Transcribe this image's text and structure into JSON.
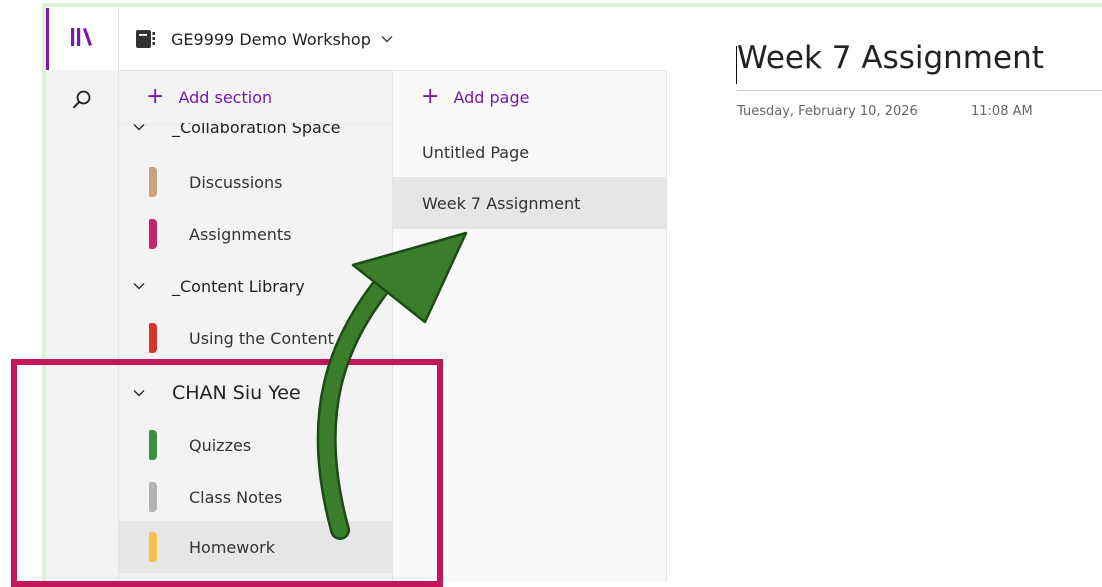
{
  "notebook": {
    "title": "GE9999 Demo Workshop",
    "chevron": "⌄"
  },
  "sections_pane": {
    "add_label": "Add section",
    "groups": [
      {
        "label": "_Collaboration Space",
        "expanded": true
      },
      {
        "label": "_Content Library",
        "expanded": true
      },
      {
        "label": "CHAN Siu Yee",
        "expanded": true
      }
    ],
    "sections": [
      {
        "label": "Discussions",
        "color": "#c9a27e"
      },
      {
        "label": "Assignments",
        "color": "#c2266b"
      },
      {
        "label": "Using the Content L",
        "color": "#d6322b"
      },
      {
        "label": "Quizzes",
        "color": "#3e8e41"
      },
      {
        "label": "Class Notes",
        "color": "#b3b3b3"
      },
      {
        "label": "Homework",
        "color": "#f4c04a",
        "selected": true
      }
    ]
  },
  "pages_pane": {
    "add_label": "Add page",
    "pages": [
      {
        "label": "Untitled Page"
      },
      {
        "label": "Week 7 Assignment",
        "selected": true
      }
    ]
  },
  "page": {
    "title": "Week 7 Assignment",
    "date": "Tuesday, February 10, 2026",
    "time": "11:08 AM"
  },
  "colors": {
    "accent": "#7719aa",
    "highlight": "#c2185b",
    "arrow": "#3a7d2a"
  },
  "icons": [
    "library-icon",
    "search-icon",
    "notebook-icon",
    "plus-icon",
    "chevron-down-icon"
  ]
}
